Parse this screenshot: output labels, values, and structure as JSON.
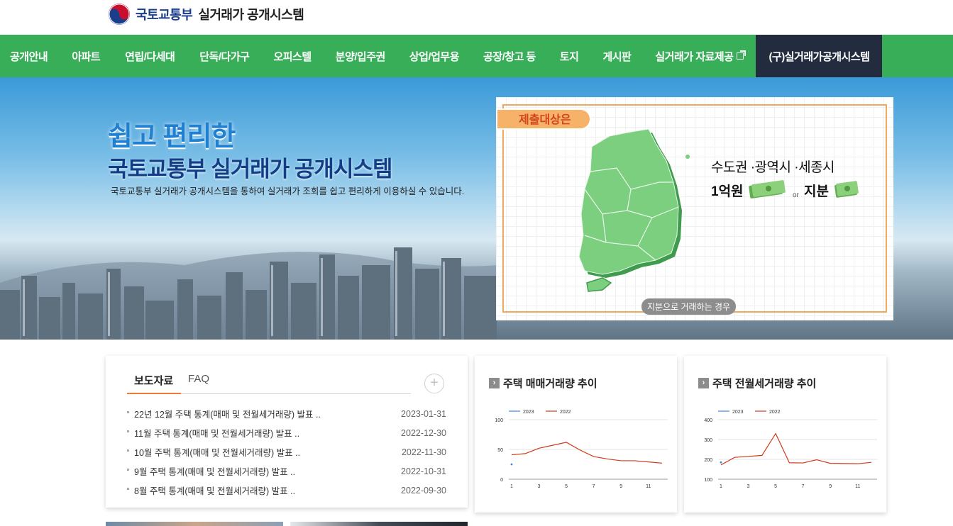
{
  "header": {
    "ministry": "국토교통부",
    "system": "실거래가 공개시스템"
  },
  "nav": {
    "items": [
      "공개안내",
      "아파트",
      "연립/다세대",
      "단독/다가구",
      "오피스텔",
      "분양/입주권",
      "상업/업무용",
      "공장/창고 등",
      "토지",
      "게시판",
      "실거래가 자료제공"
    ],
    "old_system": "(구)실거래가공개시스템"
  },
  "hero": {
    "title1": "쉽고 편리한",
    "title2": "국토교통부 실거래가 공개시스템",
    "subtitle": "국토교통부 실거래가 공개시스템을 통하여 실거래가 조회를 쉽고 편리하게 이용하실 수 있습니다.",
    "panel": {
      "tag": "제출대상은",
      "line1": "수도권 ·광역시 ·세종시",
      "line2": "1억원",
      "or": "or",
      "line3": "지분",
      "note": "지분으로 거래하는 경우"
    }
  },
  "news": {
    "tabs": [
      "보도자료",
      "FAQ"
    ],
    "more": "+",
    "items": [
      {
        "title": "22년 12월 주택 통계(매매 및 전월세거래량) 발표 ..",
        "date": "2023-01-31"
      },
      {
        "title": "11월 주택 통계(매매 및 전월세거래량) 발표 ..",
        "date": "2022-12-30"
      },
      {
        "title": "10월 주택 통계(매매 및 전월세거래량) 발표 ..",
        "date": "2022-11-30"
      },
      {
        "title": "9월 주택 통계(매매 및 전월세거래량) 발표 ..",
        "date": "2022-10-31"
      },
      {
        "title": "8월 주택 통계(매매 및 전월세거래량) 발표 ..",
        "date": "2022-09-30"
      }
    ]
  },
  "colors": {
    "green": "#39ae59",
    "navy": "#222c3e",
    "series2023": "#3f86d4",
    "series2022": "#cc3a1a"
  },
  "chart_data": [
    {
      "type": "line",
      "title": "주택 매매거래량 추이",
      "x": [
        1,
        2,
        3,
        4,
        5,
        6,
        7,
        8,
        9,
        10,
        11,
        12
      ],
      "xticks": [
        "1",
        "3",
        "5",
        "7",
        "9",
        "11"
      ],
      "yticks": [
        "0",
        "50",
        "100"
      ],
      "ylim": [
        0,
        100
      ],
      "series": [
        {
          "name": "2023",
          "values": [
            25
          ]
        },
        {
          "name": "2022",
          "values": [
            41,
            43,
            52,
            57,
            62,
            49,
            38,
            34,
            31,
            31,
            29,
            27
          ]
        }
      ],
      "legend": "top-left"
    },
    {
      "type": "line",
      "title": "주택 전월세거래량 추이",
      "x": [
        1,
        2,
        3,
        4,
        5,
        6,
        7,
        8,
        9,
        10,
        11,
        12
      ],
      "xticks": [
        "1",
        "3",
        "5",
        "7",
        "9",
        "11"
      ],
      "yticks": [
        "100",
        "200",
        "300",
        "400"
      ],
      "ylim": [
        100,
        400
      ],
      "series": [
        {
          "name": "2023",
          "values": [
            185
          ]
        },
        {
          "name": "2022",
          "values": [
            172,
            210,
            215,
            220,
            330,
            183,
            182,
            198,
            180,
            179,
            178,
            185
          ]
        }
      ],
      "legend": "top-left"
    }
  ]
}
